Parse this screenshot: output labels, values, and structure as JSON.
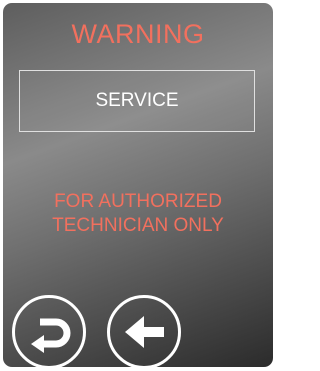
{
  "dialog": {
    "title": "WARNING",
    "service_label": "SERVICE",
    "notice_line1": "FOR AUTHORIZED",
    "notice_line2": "TECHNICIAN ONLY"
  },
  "buttons": {
    "return_icon": "return-icon",
    "back_icon": "arrow-left-icon"
  },
  "colors": {
    "warning_text": "#f2705e",
    "label_text": "#ffffff",
    "panel_top": "#5e5e5e",
    "panel_bottom": "#2b2b2b"
  }
}
